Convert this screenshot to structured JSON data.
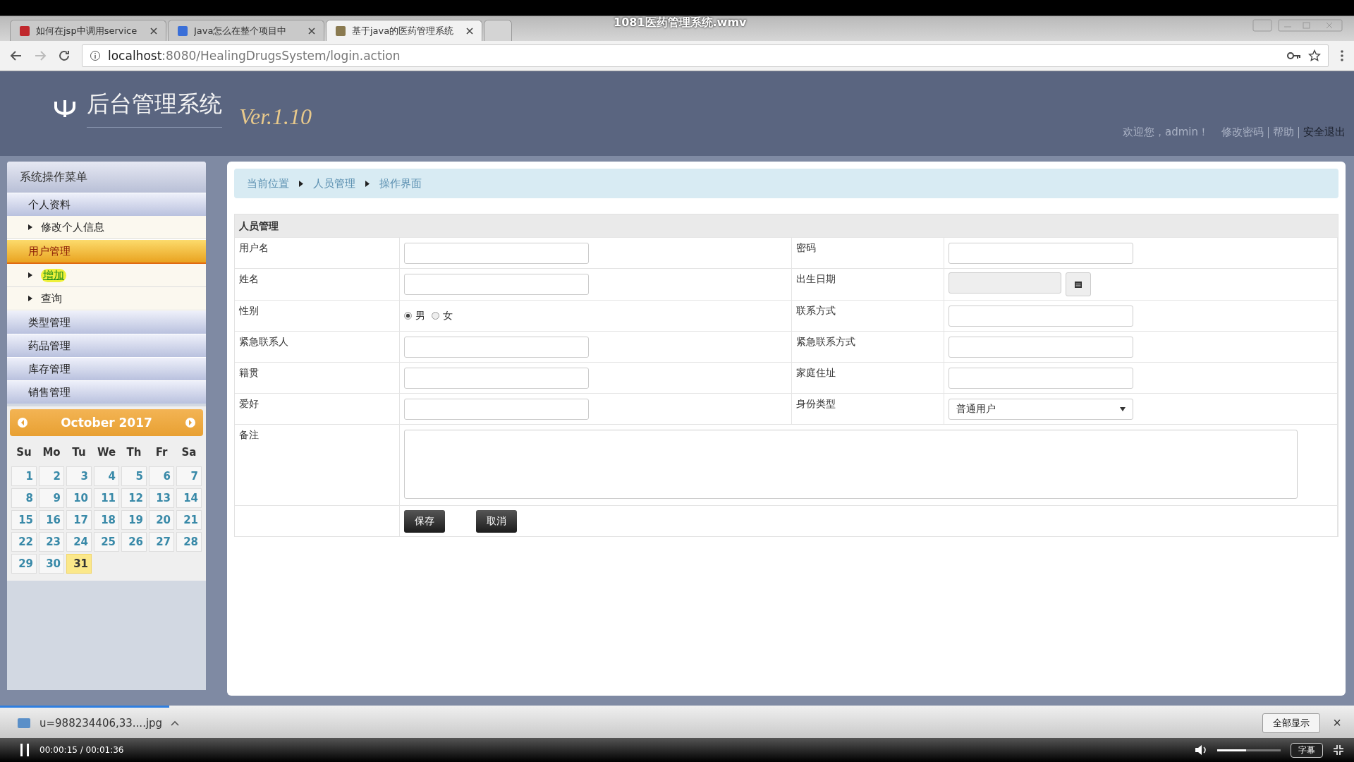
{
  "video": {
    "title": "1081医药管理系统.wmv",
    "time": "00:00:15 / 00:01:36",
    "progress": {
      "level": 0.125
    },
    "volume": {
      "level": 0.45
    },
    "subtitle_button": "字幕",
    "show_all_button": "全部显示",
    "close": "×"
  },
  "browser": {
    "tabs": [
      {
        "title": "如何在jsp中调用service",
        "selected": false
      },
      {
        "title": "Java怎么在整个项目中",
        "selected": false
      },
      {
        "title": "基于java的医药管理系统",
        "selected": true
      }
    ],
    "address": {
      "host": "localhost",
      "rest": ":8080/HealingDrugsSystem/login.action"
    }
  },
  "header": {
    "title": "后台管理系统",
    "version": "Ver.1.10",
    "welcome": "欢迎您，admin！",
    "links": [
      "修改密码",
      "帮助",
      "安全退出"
    ]
  },
  "sidebar": {
    "title": "系统操作菜单",
    "groups": [
      {
        "label": "个人资料",
        "selected": false,
        "children": [
          {
            "label": "修改个人信息",
            "hovered": false
          }
        ]
      },
      {
        "label": "用户管理",
        "selected": true,
        "children": [
          {
            "label": "增加",
            "hovered": true
          },
          {
            "label": "查询",
            "hovered": false
          }
        ]
      },
      {
        "label": "类型管理",
        "selected": false
      },
      {
        "label": "药品管理",
        "selected": false
      },
      {
        "label": "库存管理",
        "selected": false
      },
      {
        "label": "销售管理",
        "selected": false
      }
    ]
  },
  "calendar": {
    "month": "October 2017",
    "weekdays": [
      "Su",
      "Mo",
      "Tu",
      "We",
      "Th",
      "Fr",
      "Sa"
    ],
    "days": [
      {
        "label": "1",
        "today": false
      },
      {
        "label": "2",
        "today": false
      },
      {
        "label": "3",
        "today": false
      },
      {
        "label": "4",
        "today": false
      },
      {
        "label": "5",
        "today": false
      },
      {
        "label": "6",
        "today": false
      },
      {
        "label": "7",
        "today": false
      },
      {
        "label": "8",
        "today": false
      },
      {
        "label": "9",
        "today": false
      },
      {
        "label": "10",
        "today": false
      },
      {
        "label": "11",
        "today": false
      },
      {
        "label": "12",
        "today": false
      },
      {
        "label": "13",
        "today": false
      },
      {
        "label": "14",
        "today": false
      },
      {
        "label": "15",
        "today": false
      },
      {
        "label": "16",
        "today": false
      },
      {
        "label": "17",
        "today": false
      },
      {
        "label": "18",
        "today": false
      },
      {
        "label": "19",
        "today": false
      },
      {
        "label": "20",
        "today": false
      },
      {
        "label": "21",
        "today": false
      },
      {
        "label": "22",
        "today": false
      },
      {
        "label": "23",
        "today": false
      },
      {
        "label": "24",
        "today": false
      },
      {
        "label": "25",
        "today": false
      },
      {
        "label": "26",
        "today": false
      },
      {
        "label": "27",
        "today": false
      },
      {
        "label": "28",
        "today": false
      },
      {
        "label": "29",
        "today": false
      },
      {
        "label": "30",
        "today": false
      },
      {
        "label": "31",
        "today": true
      }
    ]
  },
  "breadcrumb": [
    "当前位置",
    "人员管理",
    "操作界面"
  ],
  "form": {
    "title": "人员管理",
    "rows": [
      [
        {
          "label": "用户名",
          "kind": "text"
        },
        {
          "label": "密码",
          "kind": "text"
        }
      ],
      [
        {
          "label": "姓名",
          "kind": "text"
        },
        {
          "label": "出生日期",
          "kind": "date"
        }
      ],
      [
        {
          "label": "性别",
          "kind": "radio",
          "options": [
            {
              "label": "男",
              "checked": true
            },
            {
              "label": "女",
              "checked": false
            }
          ]
        },
        {
          "label": "联系方式",
          "kind": "text"
        }
      ],
      [
        {
          "label": "紧急联系人",
          "kind": "text"
        },
        {
          "label": "紧急联系方式",
          "kind": "text"
        }
      ],
      [
        {
          "label": "籍贯",
          "kind": "text"
        },
        {
          "label": "家庭住址",
          "kind": "text"
        }
      ],
      [
        {
          "label": "爱好",
          "kind": "text"
        },
        {
          "label": "身份类型",
          "kind": "select",
          "value": "普通用户"
        }
      ]
    ],
    "note": {
      "label": "备注"
    },
    "buttons": [
      "保存",
      "取消"
    ]
  },
  "download": {
    "file": "u=988234406,33....jpg"
  }
}
